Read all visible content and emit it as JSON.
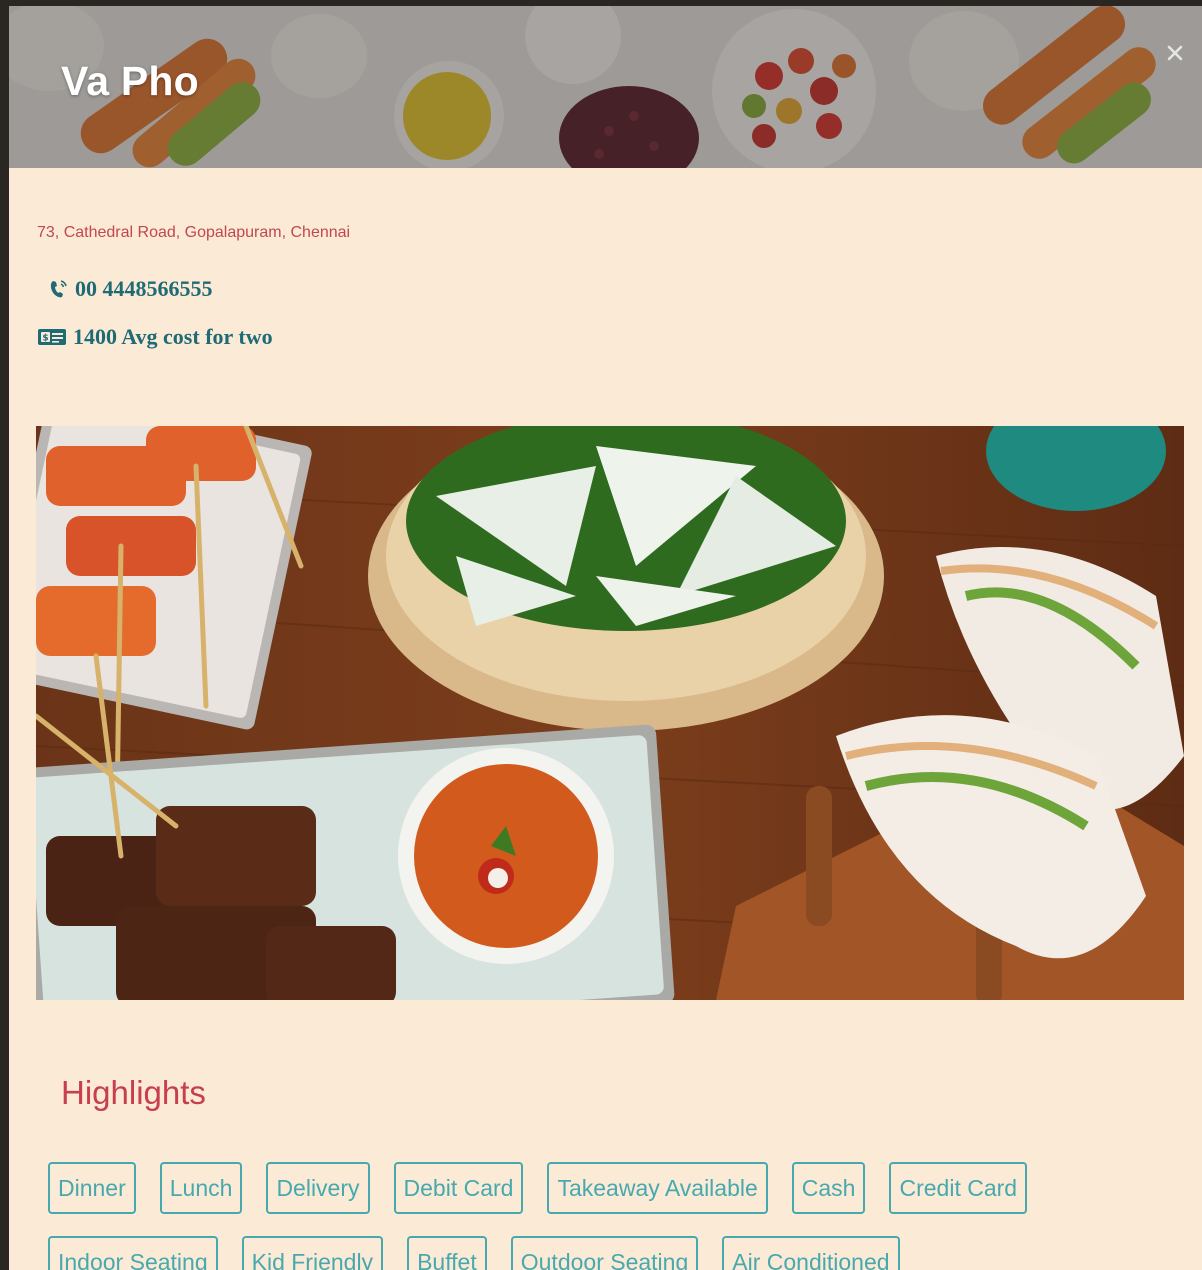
{
  "restaurant": {
    "name": "Va Pho",
    "address": "73, Cathedral Road, Gopalapuram, Chennai",
    "phone": "00 4448566555",
    "cost": "1400 Avg cost for two"
  },
  "icons": {
    "close": "close-icon",
    "phone": "phone-icon",
    "cost": "money-icon"
  },
  "highlights": {
    "title": "Highlights",
    "rows": [
      [
        "Dinner",
        "Lunch",
        "Delivery",
        "Debit Card",
        "Takeaway Available",
        "Cash",
        "Credit Card"
      ],
      [
        "Indoor Seating",
        "Kid Friendly",
        "Buffet",
        "Outdoor Seating",
        "Air Conditioned"
      ]
    ]
  },
  "colors": {
    "modal_bg": "#fbead6",
    "accent_red": "#c2474f",
    "accent_teal": "#1e6b75",
    "tag_teal": "#47a9ae"
  }
}
